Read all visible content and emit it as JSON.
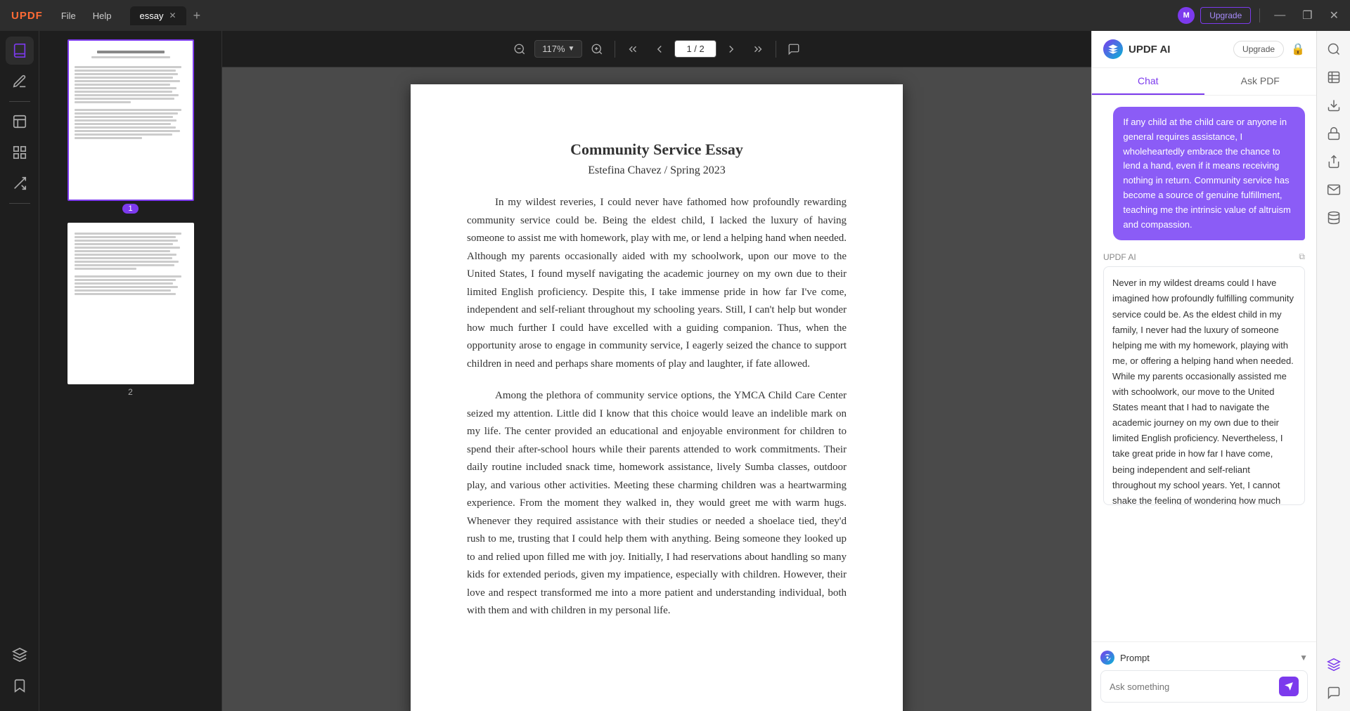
{
  "app": {
    "name": "UPDF",
    "logo_text": "UPDF"
  },
  "topbar": {
    "file_label": "File",
    "help_label": "Help",
    "tab_name": "essay",
    "upgrade_label": "Upgrade",
    "user_initial": "M",
    "win_minimize": "—",
    "win_maximize": "❐",
    "win_close": "✕"
  },
  "toolbar": {
    "zoom_level": "117%",
    "page_current": "1",
    "page_separator": "/",
    "page_total": "2"
  },
  "pdf": {
    "title": "Community Service Essay",
    "subtitle": "Estefina Chavez / Spring 2023",
    "paragraph1": "In my wildest reveries, I could never have fathomed how profoundly rewarding community service could be. Being the eldest child, I lacked the luxury of having someone to assist me with homework, play with me, or lend a helping hand when needed. Although my parents occasionally aided with my schoolwork, upon our move to the United States, I found myself navigating the academic journey on my own due to their limited English proficiency. Despite this, I take immense pride in how far I've come, independent and self-reliant throughout my schooling years. Still, I can't help but wonder how much further I could have excelled with a guiding companion. Thus, when the opportunity arose to engage in community service, I eagerly seized the chance to support children in need and perhaps share moments of play and laughter, if fate allowed.",
    "paragraph2": "Among the plethora of community service options, the YMCA Child Care Center seized my attention. Little did I know that this choice would leave an indelible mark on my life. The center provided an educational and enjoyable environment for children to spend their after-school hours while their parents attended to work commitments. Their daily routine included snack time, homework assistance, lively Sumba classes, outdoor play, and various other activities. Meeting these charming children was a heartwarming experience. From the moment they walked in, they would greet me with warm hugs. Whenever they required assistance with their studies or needed a shoelace tied, they'd rush to me, trusting that I could help them with anything. Being someone they looked up to and relied upon filled me with joy. Initially, I had reservations about handling so many kids for extended periods, given my impatience, especially with children. However, their love and respect transformed me into a more patient and understanding individual, both with them and with children in my personal life."
  },
  "pages": [
    {
      "num": "1",
      "active": true
    },
    {
      "num": "2",
      "active": false
    }
  ],
  "ai_panel": {
    "title": "UPDF AI",
    "upgrade_label": "Upgrade",
    "tab_chat": "Chat",
    "tab_ask_pdf": "Ask PDF",
    "user_message": "If any child at the child care or anyone in general requires assistance, I wholeheartedly embrace the chance to lend a hand, even if it means receiving nothing in return. Community service has become a source of genuine fulfillment, teaching me the intrinsic value of altruism and compassion.",
    "ai_label": "UPDF AI",
    "ai_response": "Never in my wildest dreams could I have imagined how profoundly fulfilling community service could be. As the eldest child in my family, I never had the luxury of someone helping me with my homework, playing with me, or offering a helping hand when needed. While my parents occasionally assisted me with schoolwork, our move to the United States meant that I had to navigate the academic journey on my own due to their limited English proficiency. Nevertheless, I take great pride in how far I have come, being independent and self-reliant throughout my school years. Yet, I cannot shake the feeling of wondering how much further I could have excelled with a guiding companion. So, when an opportunity arose to engage in community service, I eagerly seized the chance to support children in need, and perhaps, if fate allowed, share moments of play and laughter with",
    "prompt_label": "Prompt",
    "prompt_placeholder": "Ask something"
  },
  "sidebar": {
    "items": [
      {
        "id": "reader",
        "icon": "book",
        "active": true
      },
      {
        "id": "annotate",
        "icon": "pen",
        "active": false
      },
      {
        "id": "edit",
        "icon": "edit",
        "active": false
      },
      {
        "id": "organize",
        "icon": "grid",
        "active": false
      },
      {
        "id": "convert",
        "icon": "convert",
        "active": false
      },
      {
        "id": "layers",
        "icon": "layers",
        "active": false
      },
      {
        "id": "bookmark",
        "icon": "bookmark",
        "active": false
      }
    ]
  }
}
